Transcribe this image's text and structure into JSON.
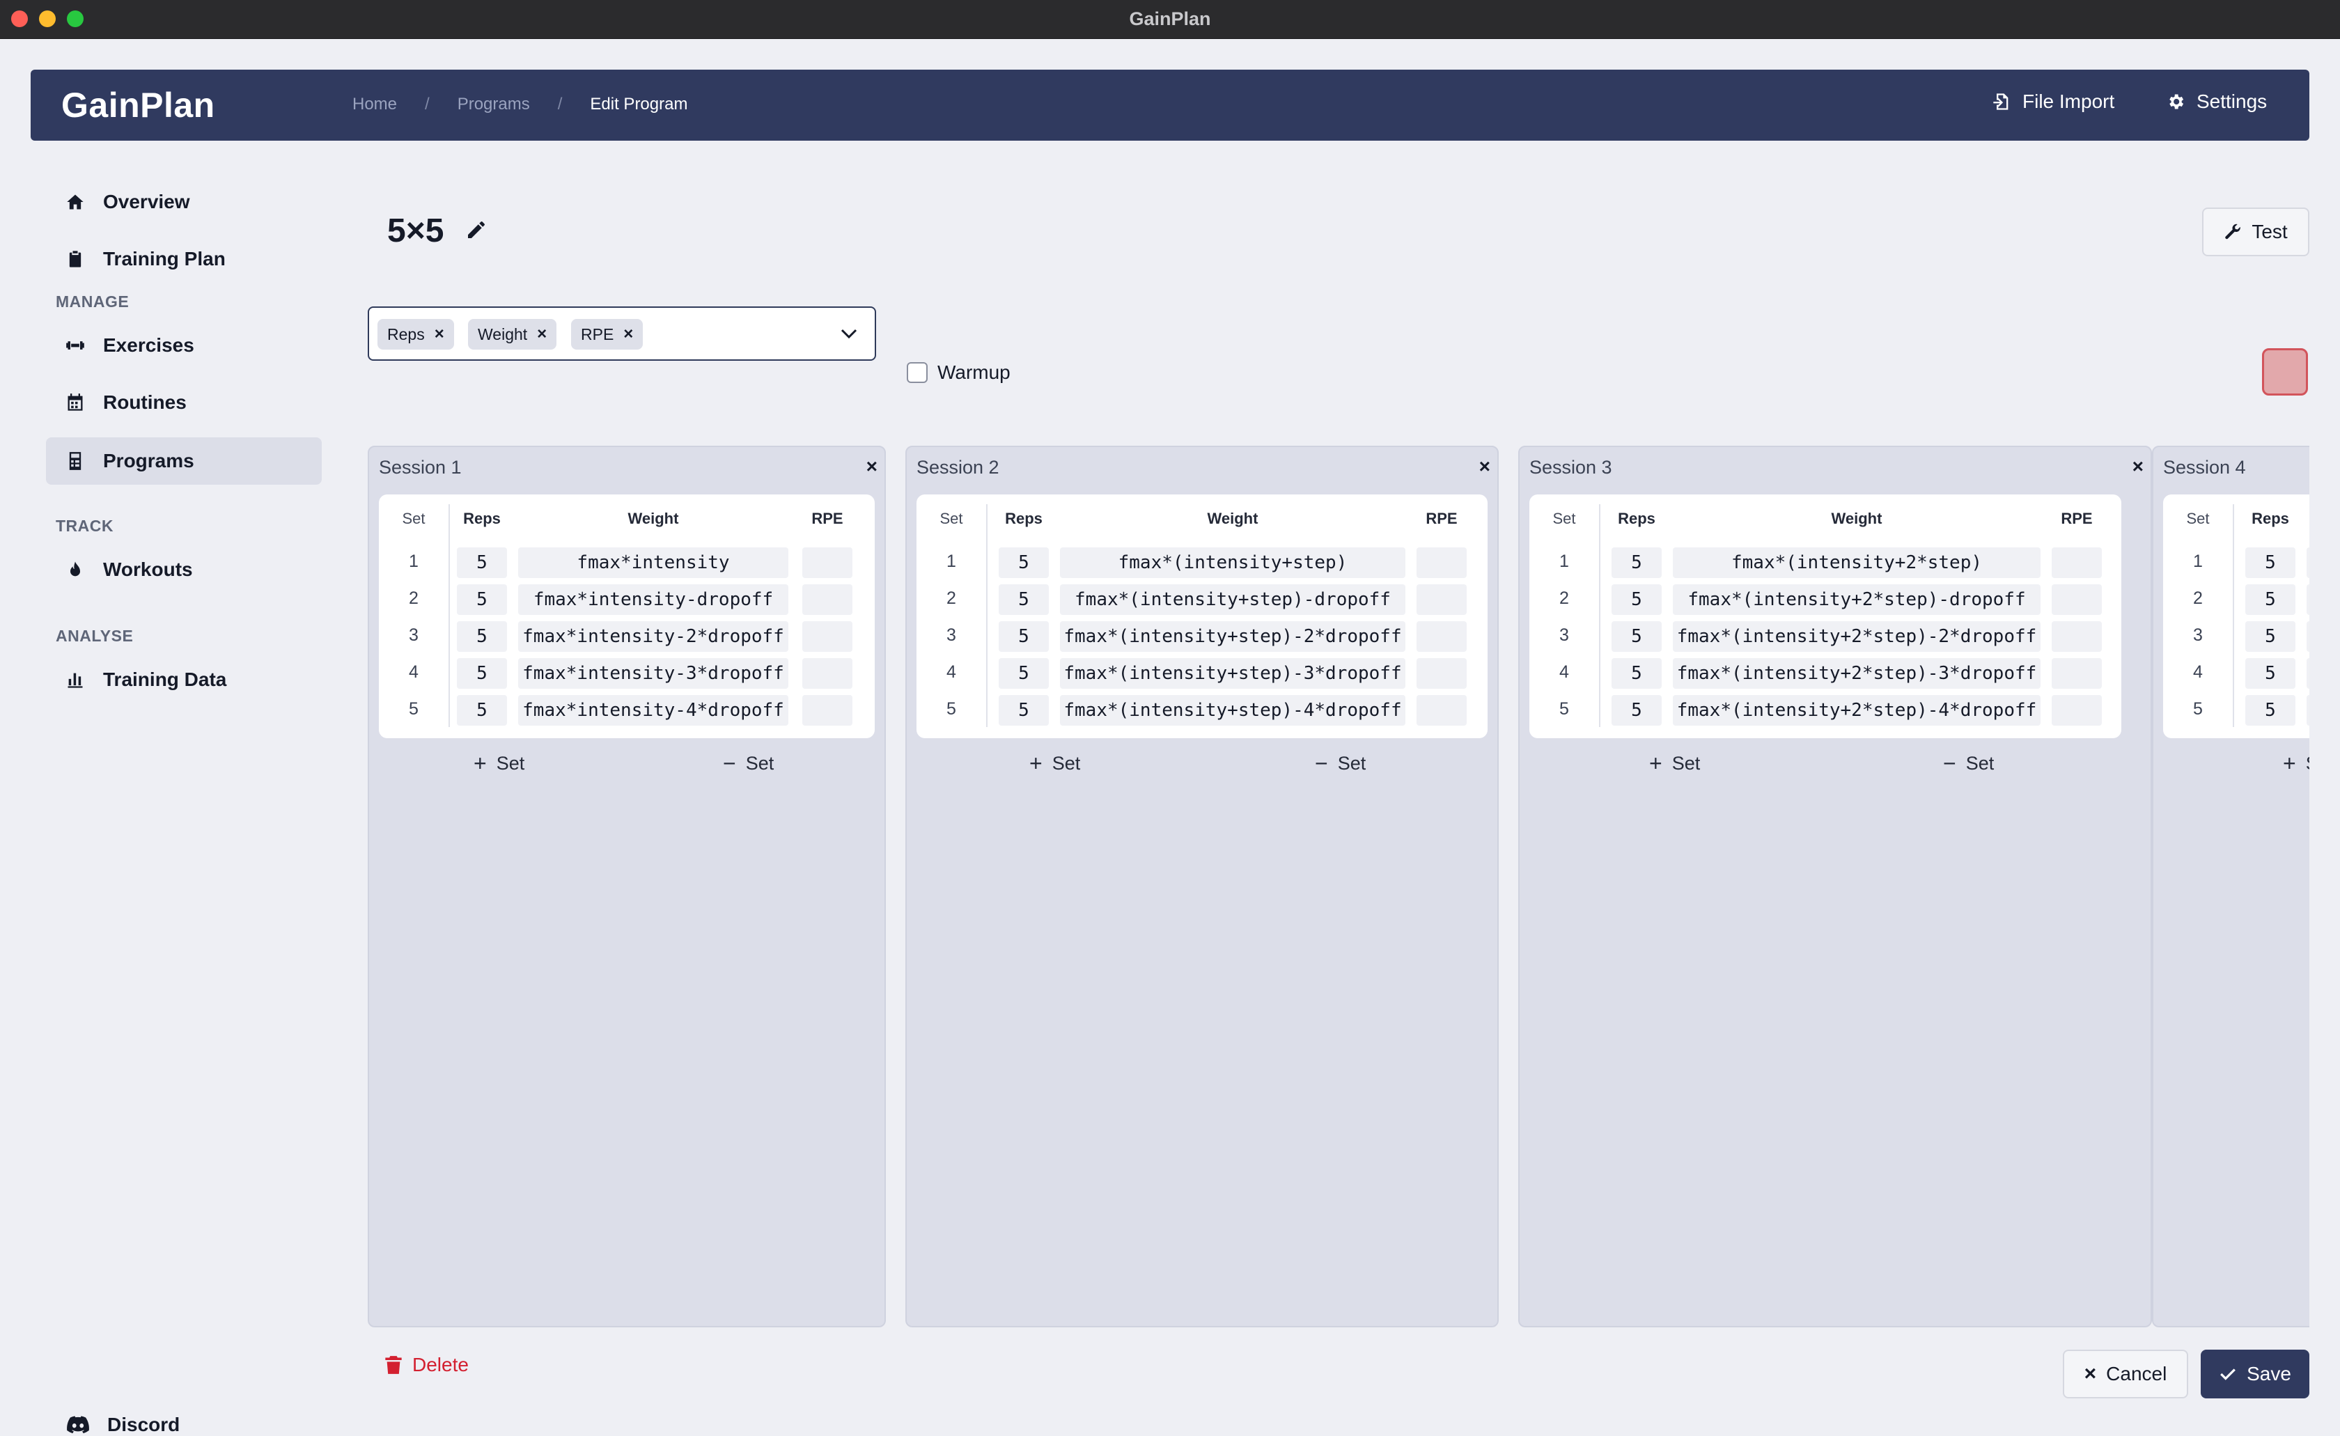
{
  "window": {
    "title": "GainPlan"
  },
  "header": {
    "logo": "GainPlan",
    "breadcrumbs": [
      "Home",
      "Programs",
      "Edit Program"
    ],
    "breadcrumb_separator": "/",
    "file_import_label": "File Import",
    "settings_label": "Settings"
  },
  "sidebar": {
    "top_items": [
      {
        "label": "Overview",
        "icon": "home-icon"
      },
      {
        "label": "Training Plan",
        "icon": "clipboard-icon"
      }
    ],
    "groups": {
      "manage": "MANAGE",
      "track": "TRACK",
      "analyse": "ANALYSE"
    },
    "manage_items": [
      {
        "label": "Exercises",
        "icon": "dumbbell-icon"
      },
      {
        "label": "Routines",
        "icon": "calendar-icon"
      },
      {
        "label": "Programs",
        "icon": "calculator-icon",
        "active": true
      }
    ],
    "track_items": [
      {
        "label": "Workouts",
        "icon": "fire-icon"
      }
    ],
    "analyse_items": [
      {
        "label": "Training Data",
        "icon": "bar-chart-icon"
      }
    ],
    "discord_label": "Discord"
  },
  "program": {
    "name": "5×5",
    "test_label": "Test",
    "attributes": [
      "Reps",
      "Weight",
      "RPE"
    ],
    "warmup_label": "Warmup",
    "warmup_checked": false,
    "color": "#e2a8ab"
  },
  "table_headers": {
    "set": "Set",
    "reps": "Reps",
    "weight": "Weight",
    "rpe": "RPE"
  },
  "sessions": [
    {
      "title": "Session 1",
      "sets": [
        {
          "num": "1",
          "reps": "5",
          "weight": "fmax*intensity",
          "rpe": ""
        },
        {
          "num": "2",
          "reps": "5",
          "weight": "fmax*intensity-dropoff",
          "rpe": ""
        },
        {
          "num": "3",
          "reps": "5",
          "weight": "fmax*intensity-2*dropoff",
          "rpe": ""
        },
        {
          "num": "4",
          "reps": "5",
          "weight": "fmax*intensity-3*dropoff",
          "rpe": ""
        },
        {
          "num": "5",
          "reps": "5",
          "weight": "fmax*intensity-4*dropoff",
          "rpe": ""
        }
      ]
    },
    {
      "title": "Session 2",
      "sets": [
        {
          "num": "1",
          "reps": "5",
          "weight": "fmax*(intensity+step)",
          "rpe": ""
        },
        {
          "num": "2",
          "reps": "5",
          "weight": "fmax*(intensity+step)-dropoff",
          "rpe": ""
        },
        {
          "num": "3",
          "reps": "5",
          "weight": "fmax*(intensity+step)-2*dropoff",
          "rpe": ""
        },
        {
          "num": "4",
          "reps": "5",
          "weight": "fmax*(intensity+step)-3*dropoff",
          "rpe": ""
        },
        {
          "num": "5",
          "reps": "5",
          "weight": "fmax*(intensity+step)-4*dropoff",
          "rpe": ""
        }
      ]
    },
    {
      "title": "Session 3",
      "sets": [
        {
          "num": "1",
          "reps": "5",
          "weight": "fmax*(intensity+2*step)",
          "rpe": ""
        },
        {
          "num": "2",
          "reps": "5",
          "weight": "fmax*(intensity+2*step)-dropoff",
          "rpe": ""
        },
        {
          "num": "3",
          "reps": "5",
          "weight": "fmax*(intensity+2*step)-2*dropoff",
          "rpe": ""
        },
        {
          "num": "4",
          "reps": "5",
          "weight": "fmax*(intensity+2*step)-3*dropoff",
          "rpe": ""
        },
        {
          "num": "5",
          "reps": "5",
          "weight": "fmax*(intensity+2*step)-4*dropoff",
          "rpe": ""
        }
      ]
    },
    {
      "title": "Session 4",
      "sets": [
        {
          "num": "1",
          "reps": "5",
          "weight": "",
          "rpe": ""
        },
        {
          "num": "2",
          "reps": "5",
          "weight": "",
          "rpe": ""
        },
        {
          "num": "3",
          "reps": "5",
          "weight": "",
          "rpe": ""
        },
        {
          "num": "4",
          "reps": "5",
          "weight": "",
          "rpe": ""
        },
        {
          "num": "5",
          "reps": "5",
          "weight": "",
          "rpe": ""
        }
      ]
    }
  ],
  "set_controls": {
    "add": "Set",
    "remove": "Set"
  },
  "footer": {
    "delete_label": "Delete",
    "cancel_label": "Cancel",
    "save_label": "Save"
  }
}
